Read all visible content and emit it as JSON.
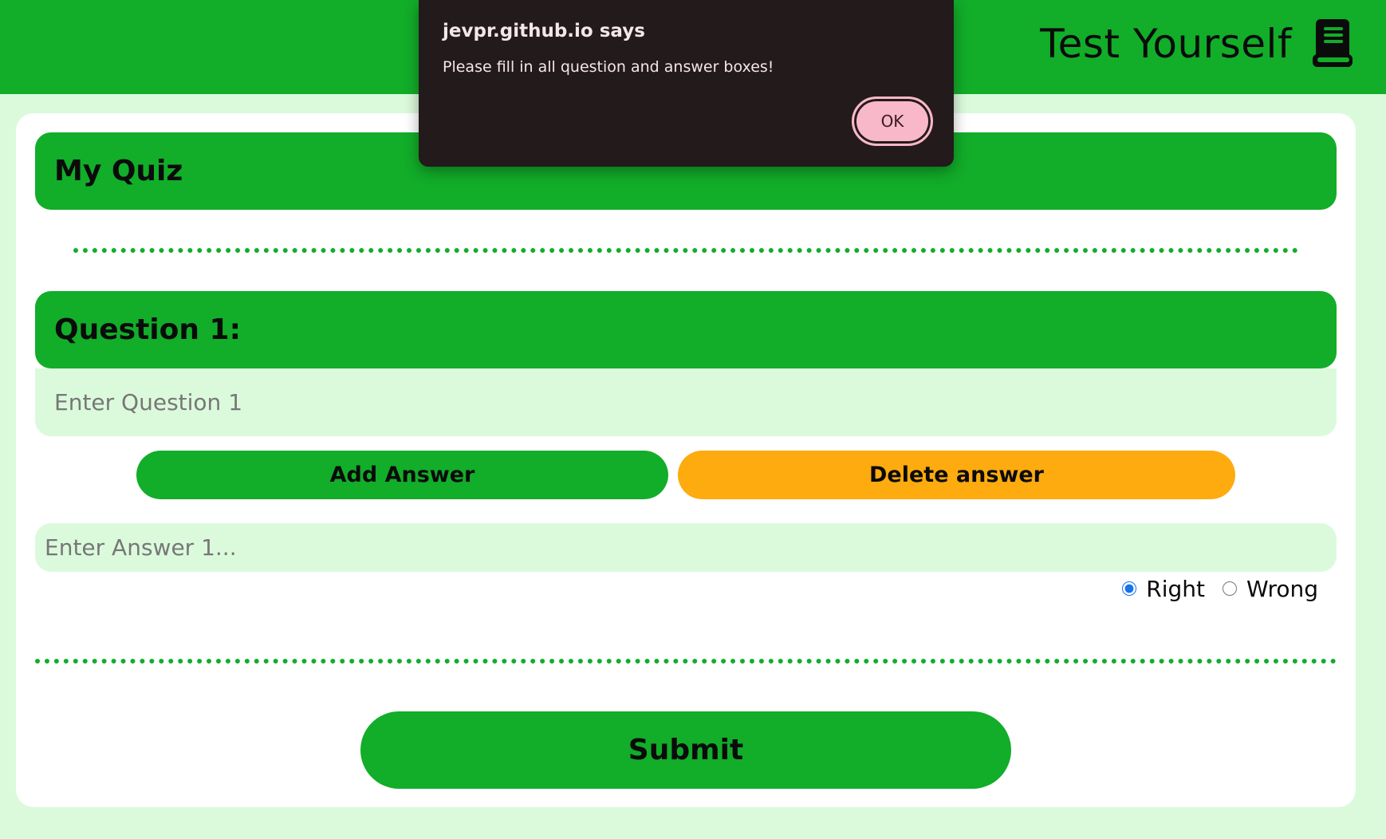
{
  "header": {
    "title": "Test Yourself",
    "icon": "book-icon"
  },
  "quiz": {
    "title": "My Quiz"
  },
  "question": {
    "label": "Question 1:",
    "placeholder": "Enter Question 1",
    "value": ""
  },
  "buttons": {
    "add_answer": "Add Answer",
    "delete_answer": "Delete answer",
    "submit": "Submit"
  },
  "answer": {
    "placeholder": "Enter Answer 1...",
    "value": "",
    "options": [
      {
        "label": "Right",
        "checked": true
      },
      {
        "label": "Wrong",
        "checked": false
      }
    ]
  },
  "alert": {
    "title": "jevpr.github.io says",
    "message": "Please fill in all question and answer boxes!",
    "ok_label": "OK"
  },
  "colors": {
    "primary_green": "#12ad29",
    "background_mint": "#dbfadc",
    "delete_orange": "#fdab0e",
    "alert_bg": "#231a1c",
    "alert_button": "#f9b8c9"
  }
}
